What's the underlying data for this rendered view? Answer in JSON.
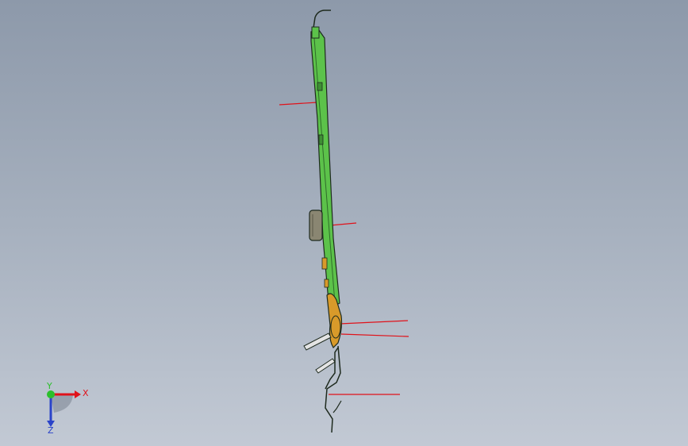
{
  "viewport": {
    "background_top": "#8d99aa",
    "background_bottom": "#c2c9d4"
  },
  "model": {
    "board_color": "#5cc24a",
    "edge_color": "#1e2a1e",
    "component_color": "#8a8672",
    "connector_color": "#d89a2a",
    "leader_color": "#e0121a",
    "pin_color": "#e4e4e4"
  },
  "triad": {
    "x_label": "X",
    "y_label": "Y",
    "z_label": "Z",
    "x_color": "#e0121a",
    "y_color": "#2bbf2b",
    "z_color": "#2a43c9"
  }
}
